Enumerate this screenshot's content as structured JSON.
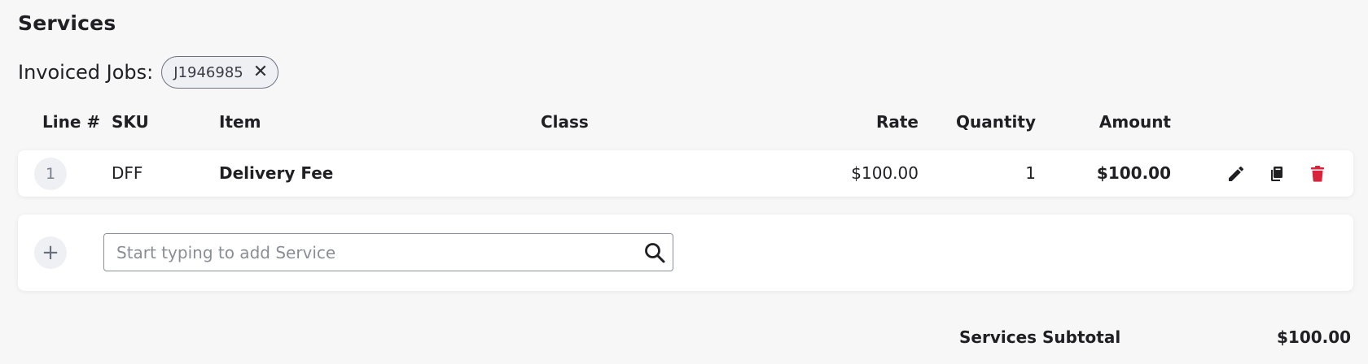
{
  "section": {
    "title": "Services"
  },
  "invoiced_jobs": {
    "label": "Invoiced Jobs:",
    "chips": [
      {
        "label": "J1946985"
      }
    ]
  },
  "table": {
    "headers": {
      "line": "Line #",
      "sku": "SKU",
      "item": "Item",
      "class": "Class",
      "rate": "Rate",
      "quantity": "Quantity",
      "amount": "Amount"
    },
    "rows": [
      {
        "line": "1",
        "sku": "DFF",
        "item": "Delivery Fee",
        "class": "",
        "rate": "$100.00",
        "quantity": "1",
        "amount": "$100.00"
      }
    ],
    "row_actions": [
      "pencil-icon",
      "copy-icon",
      "trash-icon"
    ]
  },
  "add_service": {
    "placeholder": "Start typing to add Service",
    "value": ""
  },
  "subtotal": {
    "label": "Services Subtotal",
    "value": "$100.00"
  },
  "colors": {
    "delete": "#d9233a",
    "chip_bg": "#eef0f4",
    "chip_border": "#6e7280"
  }
}
